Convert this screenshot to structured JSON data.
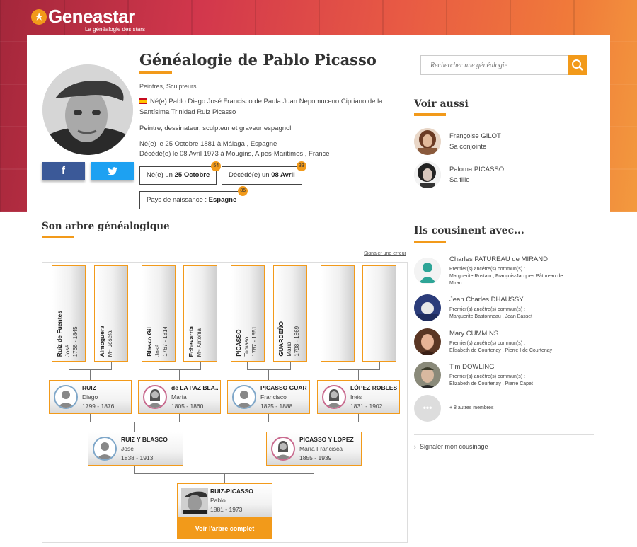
{
  "brand": {
    "name": "Geneastar",
    "tagline": "La généalogie des stars"
  },
  "profile": {
    "title": "Généalogie de Pablo Picasso",
    "categories": "Peintres, Sculpteurs",
    "fullname_l1": "Né(e) Pablo Diego José Francisco de Paula Juan Nepomuceno Cipriano de la",
    "fullname_l2": "Santísima Trinidad Ruiz Picasso",
    "description": "Peintre, dessinateur, sculpteur et graveur espagnol",
    "born": "Né(e) le 25 Octobre 1881 à Málaga , Espagne",
    "died": "Décédé(e) le 08 Avril 1973 à Mougins, Alpes-Maritimes , France",
    "birth_label": "Né(e) un ",
    "birth_value": "25 Octobre",
    "birth_count": "54",
    "death_label": "Décédé(e) un ",
    "death_value": "08 Avril",
    "death_count": "33",
    "country_label": "Pays de naissance : ",
    "country_value": "Espagne",
    "country_count": "85"
  },
  "share": {
    "facebook": "f",
    "twitter": "t"
  },
  "search": {
    "placeholder": "Rechercher une généalogie"
  },
  "see_also": {
    "title": "Voir aussi",
    "items": [
      {
        "name": "Françoise GILOT",
        "relation": "Sa conjointe"
      },
      {
        "name": "Paloma PICASSO",
        "relation": "Sa fille"
      }
    ]
  },
  "tree": {
    "title": "Son arbre généalogique",
    "report": "Signaler une erreur",
    "gen3": [
      {
        "last": "Ruiz de Fuentes",
        "first": "José",
        "dates": "1766 - 1845"
      },
      {
        "last": "Almoguera",
        "first": "M~ Josefa",
        "dates": ""
      },
      {
        "last": "Blasco Gil",
        "first": "José",
        "dates": "1767 - 1814"
      },
      {
        "last": "Echevarría",
        "first": "M~ Antonia",
        "dates": ""
      },
      {
        "last": "PICASSO",
        "first": "Tomaso",
        "dates": "1787 - 1851"
      },
      {
        "last": "GUARDEÑO",
        "first": "María",
        "dates": "1798 - 1869"
      },
      {
        "last": "",
        "first": "",
        "dates": ""
      },
      {
        "last": "",
        "first": "",
        "dates": ""
      }
    ],
    "gen2": [
      {
        "last": "RUIZ",
        "first": "Diego",
        "dates": "1799 - 1876"
      },
      {
        "last": "de LA PAZ BLA...",
        "first": "María",
        "dates": "1805 - 1860"
      },
      {
        "last": "PICASSO GUAR...",
        "first": "Francisco",
        "dates": "1825 - 1888"
      },
      {
        "last": "LÓPEZ ROBLES",
        "first": "Inés",
        "dates": "1831 - 1902"
      }
    ],
    "gen1": [
      {
        "last": "RUIZ Y BLASCO",
        "first": "José",
        "dates": "1838 - 1913"
      },
      {
        "last": "PICASSO Y LOPEZ",
        "first": "María Francisca",
        "dates": "1855 - 1939"
      }
    ],
    "root": {
      "last": "RUIZ-PICASSO",
      "first": "Pablo",
      "dates": "1881 - 1973"
    },
    "full_button": "Voir l'arbre complet"
  },
  "cousins": {
    "title": "Ils cousinent avec...",
    "items": [
      {
        "name": "Charles PATUREAU de MIRAND",
        "ancestors_label": "Premier(s) ancêtre(s) commun(s) :",
        "ancestors_l1": "Marguerite Rostain , François-Jacques Pâtureau de",
        "ancestors_l2": "Miran"
      },
      {
        "name": "Jean Charles DHAUSSY",
        "ancestors_label": "Premier(s) ancêtre(s) commun(s) :",
        "ancestors_l1": "Marguerite Bastonneau , Jean Basset",
        "ancestors_l2": ""
      },
      {
        "name": "Mary CUMMINS",
        "ancestors_label": "Premier(s) ancêtre(s) commun(s) :",
        "ancestors_l1": "Elisabeth de Courtenay , Pierre I de Courtenay",
        "ancestors_l2": ""
      },
      {
        "name": "Tim DOWLING",
        "ancestors_label": "Premier(s) ancêtre(s) commun(s) :",
        "ancestors_l1": "Elizabeth de Courtenay , Pierre Capet",
        "ancestors_l2": ""
      }
    ],
    "more_icon": "•••",
    "more": "+ 8 autres membres",
    "report": "Signaler mon cousinage"
  }
}
